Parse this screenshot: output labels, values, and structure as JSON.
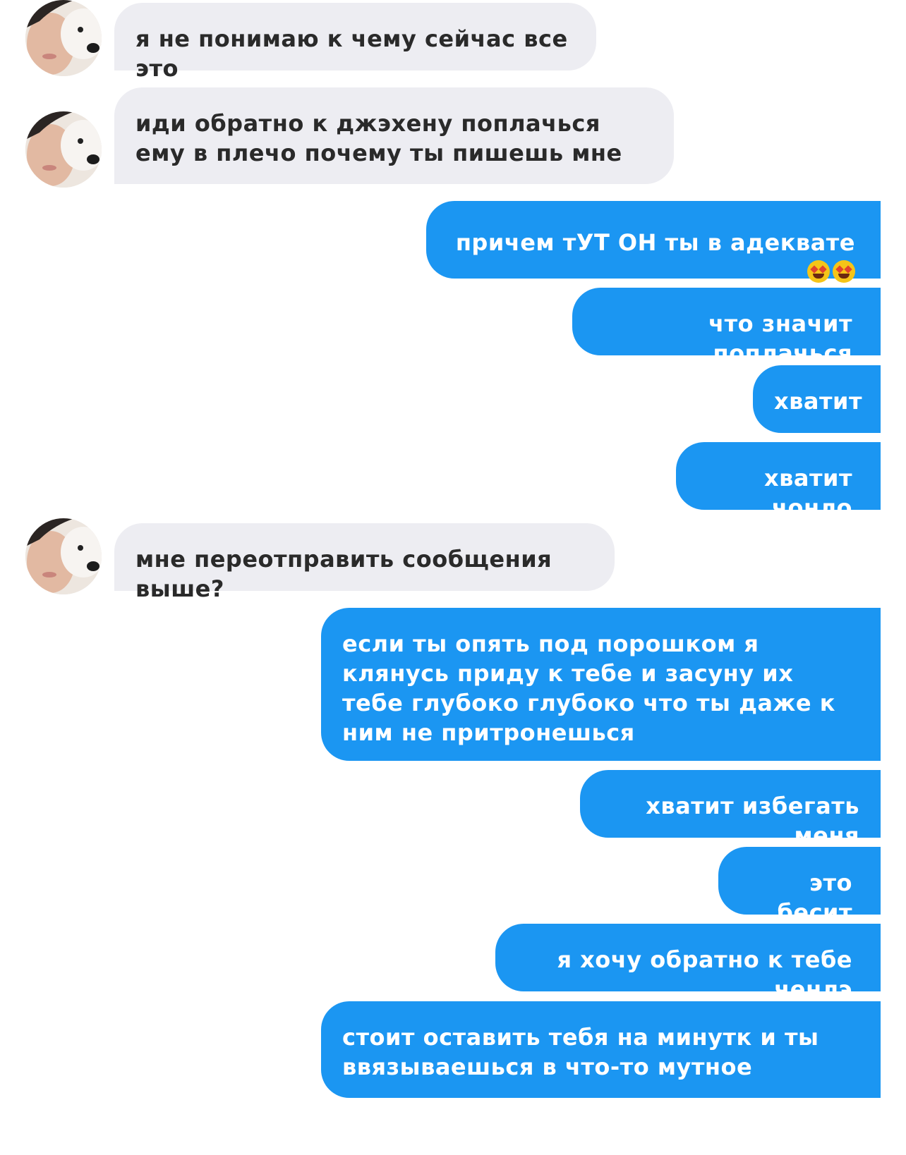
{
  "chat": {
    "messages": [
      {
        "sender": "other",
        "text": "я не понимаю к чему сейчас все это"
      },
      {
        "sender": "other",
        "text": "иди обратно к джэхену поплачься ему в плечо почему ты пишешь мне"
      },
      {
        "sender": "me",
        "text": "причем тУТ ОН ты в адеквате",
        "emoji": "star-struck-emoji"
      },
      {
        "sender": "me",
        "text": "что значит поплачься"
      },
      {
        "sender": "me",
        "text": "хватит"
      },
      {
        "sender": "me",
        "text": "хватит чонло"
      },
      {
        "sender": "other",
        "text": "мне переотправить сообщения выше?"
      },
      {
        "sender": "me",
        "text": "если ты опять под порошком я клянусь приду к тебе и засуну их тебе глубоко глубоко что ты даже к ним не притронешься"
      },
      {
        "sender": "me",
        "text": "хватит избегать меня"
      },
      {
        "sender": "me",
        "text": "это бесит"
      },
      {
        "sender": "me",
        "text": "я хочу обратно к тебе ченлэ"
      },
      {
        "sender": "me",
        "text": "стоит оставить тебя на минутк и ты ввязываешься в что-то мутное"
      }
    ]
  },
  "colors": {
    "incoming_bubble": "#ededf2",
    "incoming_text": "#2a2a2a",
    "outgoing_bubble": "#1b96f2",
    "outgoing_text": "#ffffff"
  }
}
